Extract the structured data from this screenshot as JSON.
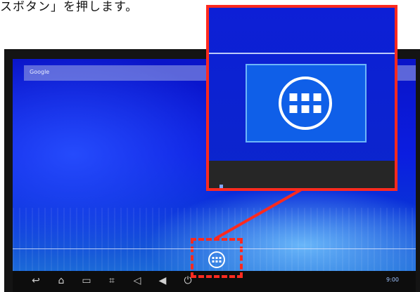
{
  "caption": "スボタン」を押します。",
  "search_bar": {
    "label": "Google"
  },
  "apps_button": {
    "icon": "apps-grid-icon"
  },
  "navbar": {
    "icons": [
      "back-icon",
      "home-icon",
      "recent-apps-icon",
      "screenshot-icon",
      "volume-down-icon",
      "volume-up-icon",
      "power-icon"
    ],
    "clock": "9:00"
  },
  "highlight_color": "#ff2a1f"
}
